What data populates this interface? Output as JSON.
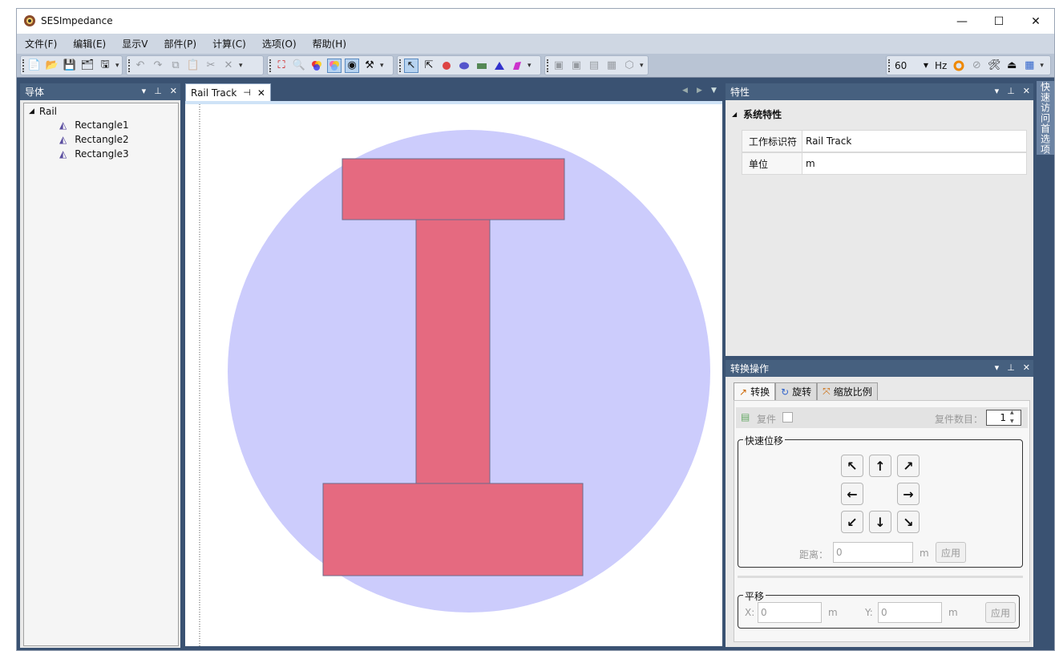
{
  "app": {
    "title": "SESImpedance"
  },
  "window_controls": {
    "minimize": "—",
    "maximize": "☐",
    "close": "✕"
  },
  "menu": [
    "文件(F)",
    "编辑(E)",
    "显示V",
    "部件(P)",
    "计算(C)",
    "选项(O)",
    "帮助(H)"
  ],
  "toolbar": {
    "frequency": "60",
    "unit": "Hz"
  },
  "left_panel": {
    "title": "导体",
    "tree": {
      "root": "Rail",
      "children": [
        "Rectangle1",
        "Rectangle2",
        "Rectangle3"
      ]
    }
  },
  "document": {
    "tab": "Rail Track",
    "colors": {
      "circle": "#ccccfc",
      "shape": "#e56a80",
      "shape_border": "#6b6b8b"
    }
  },
  "properties": {
    "title": "特性",
    "section": "系统特性",
    "rows": [
      {
        "key": "工作标识符",
        "value": "Rail Track"
      },
      {
        "key": "单位",
        "value": "m"
      }
    ]
  },
  "transform": {
    "title": "转换操作",
    "tabs": [
      "转换",
      "旋转",
      "缩放比例"
    ],
    "copy_label": "复件",
    "copy_count_label": "复件数目：",
    "copy_count": "1",
    "quick_move_label": "快速位移",
    "distance_label": "距离：",
    "distance_value": "0",
    "distance_unit": "m",
    "apply_label": "应用",
    "translate_label": "平移",
    "x_label": "X:",
    "x_value": "0",
    "y_label": "Y:",
    "y_value": "0",
    "unit": "m"
  },
  "side_tab": "快速访问首选项"
}
